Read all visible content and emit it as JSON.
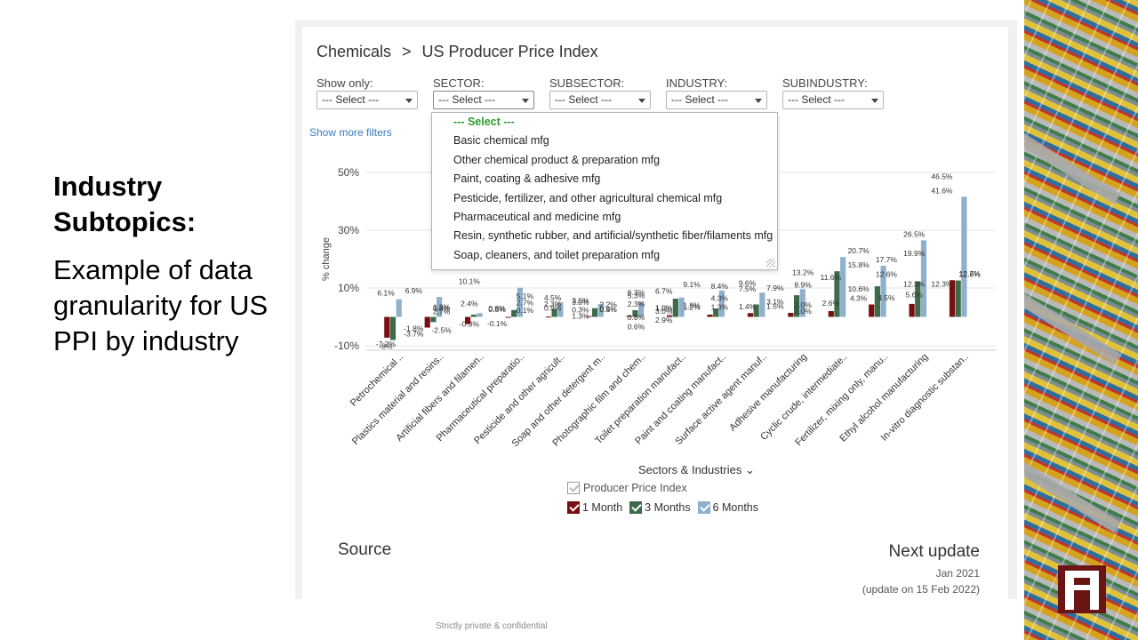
{
  "slide": {
    "heading": "Industry Subtopics:",
    "body": "Example of data granularity for US PPI by industry",
    "footer": "Strictly private & confidential"
  },
  "app": {
    "breadcrumb": [
      "Chemicals",
      ">",
      "US Producer Price Index"
    ],
    "filters": {
      "show_only_label": "Show only:",
      "sector_label": "SECTOR:",
      "subsector_label": "SUBSECTOR:",
      "industry_label": "INDUSTRY:",
      "subindustry_label": "SUBINDUSTRY:",
      "select_value": "--- Select ---"
    },
    "show_more_filters": "Show more filters",
    "dropdown_options": [
      "--- Select ---",
      "Basic chemical mfg",
      "Other chemical product & preparation mfg",
      "Paint, coating & adhesive mfg",
      "Pesticide, fertilizer, and other agricultural chemical mfg",
      "Pharmaceutical and medicine mfg",
      "Resin, synthetic rubber, and artificial/synthetic fiber/filaments mfg",
      "Soap, cleaners, and toilet preparation mfg"
    ],
    "x_axis_title": "Sectors & Industries",
    "legend_main": "Producer Price Index",
    "legend_items": [
      "1 Month",
      "3 Months",
      "6 Months"
    ],
    "source_title": "Source",
    "next_update_title": "Next update",
    "next_update_date": "Jan 2021",
    "next_update_note": "(update on 15 Feb 2022)"
  },
  "colors": {
    "one_month": "#7a0f12",
    "three_months": "#3d6b4a",
    "six_months": "#8fb0cc",
    "link": "#3a7bbf",
    "selected_option": "#2a9a2a",
    "logo": "#6b1414"
  },
  "chart_data": {
    "type": "bar",
    "ylabel": "% change",
    "xlabel": "Sectors & Industries",
    "y_ticks": [
      "50%",
      "30%",
      "10%",
      "-10%"
    ],
    "ylim": [
      -10,
      50
    ],
    "x_tick_labels": [
      "Petrochemical ..",
      "Plastics material and resins..",
      "Artificial fibers and filamen..",
      "Pharmaceutical preparatio..",
      "Pesticide and other agricult..",
      "Soap and other detergent m..",
      "Photographic film and chem..",
      "Toilet preparation manufact..",
      "Paint and coating manufact..",
      "Surface active agent manuf..",
      "Adhesive manufacturing",
      "Cyclic crude, intermediate..",
      "Fertilizer, mixing only, manu..",
      "Ethyl alcohol manufacturing",
      "In-vitro diagnostic substan.."
    ],
    "series": [
      {
        "name": "1 Month",
        "values": [
          -7.2,
          -3.7,
          -2.5,
          -0.3,
          0.1,
          0.3,
          0.4,
          0.6,
          0.8,
          1.3,
          1.4,
          2.0,
          4.3,
          4.5,
          12.7
        ]
      },
      {
        "name": "3 Months",
        "values": [
          -8.0,
          -1.8,
          0.8,
          2.4,
          2.7,
          3.0,
          2.3,
          6.3,
          2.9,
          4.3,
          7.5,
          15.8,
          10.6,
          12.3,
          12.6
        ]
      },
      {
        "name": "6 Months",
        "values": [
          6.1,
          6.9,
          1.3,
          10.1,
          5.1,
          4.5,
          5.3,
          6.7,
          9.1,
          8.4,
          9.6,
          20.7,
          17.7,
          26.5,
          41.6
        ]
      }
    ],
    "data_labels": [
      {
        "text": "6.1%",
        "cat": 0,
        "s": 2
      },
      {
        "text": "-7.2%",
        "cat": 0,
        "s": 0
      },
      {
        "text": "-8%",
        "cat": 0,
        "s": 1
      },
      {
        "text": "6.9%",
        "cat": 1,
        "s": 2
      },
      {
        "text": "-3.7%",
        "cat": 1,
        "s": 0
      },
      {
        "text": "-1.8%",
        "cat": 1,
        "s": 1
      },
      {
        "text": "1.3%",
        "cat": 2,
        "s": 2
      },
      {
        "text": "-2.5%",
        "cat": 2,
        "s": 0
      },
      {
        "text": "0.8%",
        "cat": 2,
        "s": 1
      },
      {
        "text": "2.7%",
        "cat": 2,
        "s": 1
      },
      {
        "text": "10.1%",
        "cat": 3,
        "s": 2
      },
      {
        "text": "2.4%",
        "cat": 3,
        "s": 1
      },
      {
        "text": "-0.3%",
        "cat": 3,
        "s": 0
      },
      {
        "text": "0.8%",
        "cat": 4,
        "s": 2
      },
      {
        "text": "0.5%",
        "cat": 4,
        "s": 1
      },
      {
        "text": "-0.1%",
        "cat": 4,
        "s": 0
      },
      {
        "text": "5.1%",
        "cat": 5,
        "s": 2
      },
      {
        "text": "2.7%",
        "cat": 5,
        "s": 1
      },
      {
        "text": "0.1%",
        "cat": 5,
        "s": 0
      },
      {
        "text": "4.5%",
        "cat": 6,
        "s": 2
      },
      {
        "text": "2.3%",
        "cat": 6,
        "s": 1
      },
      {
        "text": "0.9%",
        "cat": 6,
        "s": 0
      },
      {
        "text": "3.0%",
        "cat": 7,
        "s": 1
      },
      {
        "text": "3.6%",
        "cat": 7,
        "s": 2
      },
      {
        "text": "1.3%",
        "cat": 7,
        "s": 1
      },
      {
        "text": "0.3%",
        "cat": 7,
        "s": 0
      },
      {
        "text": "2.2%",
        "cat": 8,
        "s": 2
      },
      {
        "text": "0.5%",
        "cat": 8,
        "s": 1
      },
      {
        "text": "0.4%",
        "cat": 8,
        "s": 0
      },
      {
        "text": "5.3%",
        "cat": 9,
        "s": 2
      },
      {
        "text": "6.3%",
        "cat": 9,
        "s": 1
      },
      {
        "text": "2.3%",
        "cat": 9,
        "s": 0
      },
      {
        "text": "0.8%",
        "cat": 9,
        "s": 0
      },
      {
        "text": "0.6%",
        "cat": 9,
        "s": 0
      },
      {
        "text": "6.7%",
        "cat": 10,
        "s": 2
      },
      {
        "text": "1.0%",
        "cat": 10,
        "s": 0
      },
      {
        "text": "1.0%",
        "cat": 10,
        "s": 1
      },
      {
        "text": "3.0%",
        "cat": 10,
        "s": 1
      },
      {
        "text": "2.9%",
        "cat": 10,
        "s": 1
      },
      {
        "text": "9.1%",
        "cat": 11,
        "s": 2
      },
      {
        "text": "1.2%",
        "cat": 11,
        "s": 1
      },
      {
        "text": "1.8%",
        "cat": 11,
        "s": 0
      },
      {
        "text": "8.4%",
        "cat": 12,
        "s": 2
      },
      {
        "text": "4.3%",
        "cat": 12,
        "s": 1
      },
      {
        "text": "1.3%",
        "cat": 12,
        "s": 0
      },
      {
        "text": "9.6%",
        "cat": 13,
        "s": 2
      },
      {
        "text": "7.5%",
        "cat": 13,
        "s": 1
      },
      {
        "text": "1.4%",
        "cat": 13,
        "s": 0
      },
      {
        "text": "7.9%",
        "cat": 14,
        "s": 2
      },
      {
        "text": "3.1%",
        "cat": 14,
        "s": 1
      },
      {
        "text": "1.5%",
        "cat": 14,
        "s": 0
      },
      {
        "text": "8.9%",
        "cat": 15,
        "s": 2
      },
      {
        "text": "13.2%",
        "cat": 15,
        "s": 1
      },
      {
        "text": "2.0%",
        "cat": 15,
        "s": 0
      },
      {
        "text": "3.0%",
        "cat": 15,
        "s": 1
      },
      {
        "text": "11.6%",
        "cat": 16,
        "s": 2
      },
      {
        "text": "2.6%",
        "cat": 16,
        "s": 0
      },
      {
        "text": "20.7%",
        "cat": 17,
        "s": 2
      },
      {
        "text": "15.8%",
        "cat": 17,
        "s": 1
      },
      {
        "text": "10.6%",
        "cat": 17,
        "s": 1
      },
      {
        "text": "4.3%",
        "cat": 17,
        "s": 0
      },
      {
        "text": "17.7%",
        "cat": 18,
        "s": 2
      },
      {
        "text": "12.6%",
        "cat": 18,
        "s": 1
      },
      {
        "text": "4.5%",
        "cat": 18,
        "s": 0
      },
      {
        "text": "26.5%",
        "cat": 19,
        "s": 2
      },
      {
        "text": "19.9%",
        "cat": 19,
        "s": 1
      },
      {
        "text": "5.6%",
        "cat": 19,
        "s": 0
      },
      {
        "text": "12.3%",
        "cat": 19,
        "s": 1
      },
      {
        "text": "46.5%",
        "cat": 20,
        "s": 2
      },
      {
        "text": "41.6%",
        "cat": 20,
        "s": 1
      },
      {
        "text": "12.3%",
        "cat": 20,
        "s": 1
      },
      {
        "text": "12.7%",
        "cat": 21,
        "s": 2
      },
      {
        "text": "12.6%",
        "cat": 21,
        "s": 1
      }
    ],
    "grid": true,
    "legend": "bottom"
  }
}
